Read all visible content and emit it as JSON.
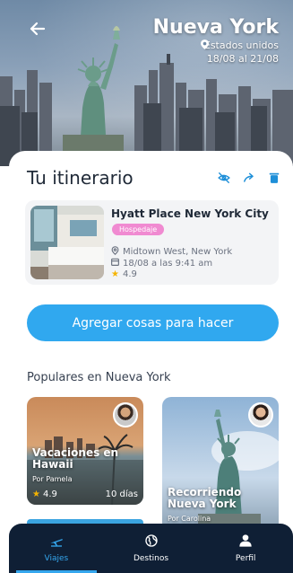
{
  "header": {
    "title": "Nueva York",
    "subtitle": "Estados unidos",
    "dates": "18/08 al 21/08"
  },
  "itinerary": {
    "title": "Tu itinerario",
    "icons": [
      "eye-off-icon",
      "share-icon",
      "trash-icon"
    ]
  },
  "stay": {
    "name": "Hyatt Place New York City",
    "badge": "Hospedaje",
    "location": "Midtown West, New York",
    "checkin": "18/08 a las 9:41 am",
    "rating": "4.9"
  },
  "actions": {
    "add_label": "Agregar cosas para hacer"
  },
  "popular": {
    "title": "Populares en Nueva York",
    "cards": [
      {
        "title": "Vacaciones en Hawaii",
        "author": "Por Pamela",
        "rating": "4.9",
        "duration": "10 días"
      },
      {
        "title": "Recorriendo Nueva York",
        "author": "Por Carolina"
      }
    ]
  },
  "nav": {
    "items": [
      {
        "label": "Viajes",
        "icon": "plane-icon",
        "active": true
      },
      {
        "label": "Destinos",
        "icon": "globe-icon",
        "active": false
      },
      {
        "label": "Perfil",
        "icon": "user-icon",
        "active": false
      }
    ]
  },
  "colors": {
    "accent": "#30a8ef",
    "badge": "#f08ad1",
    "nav_bg": "#0f1f35"
  }
}
